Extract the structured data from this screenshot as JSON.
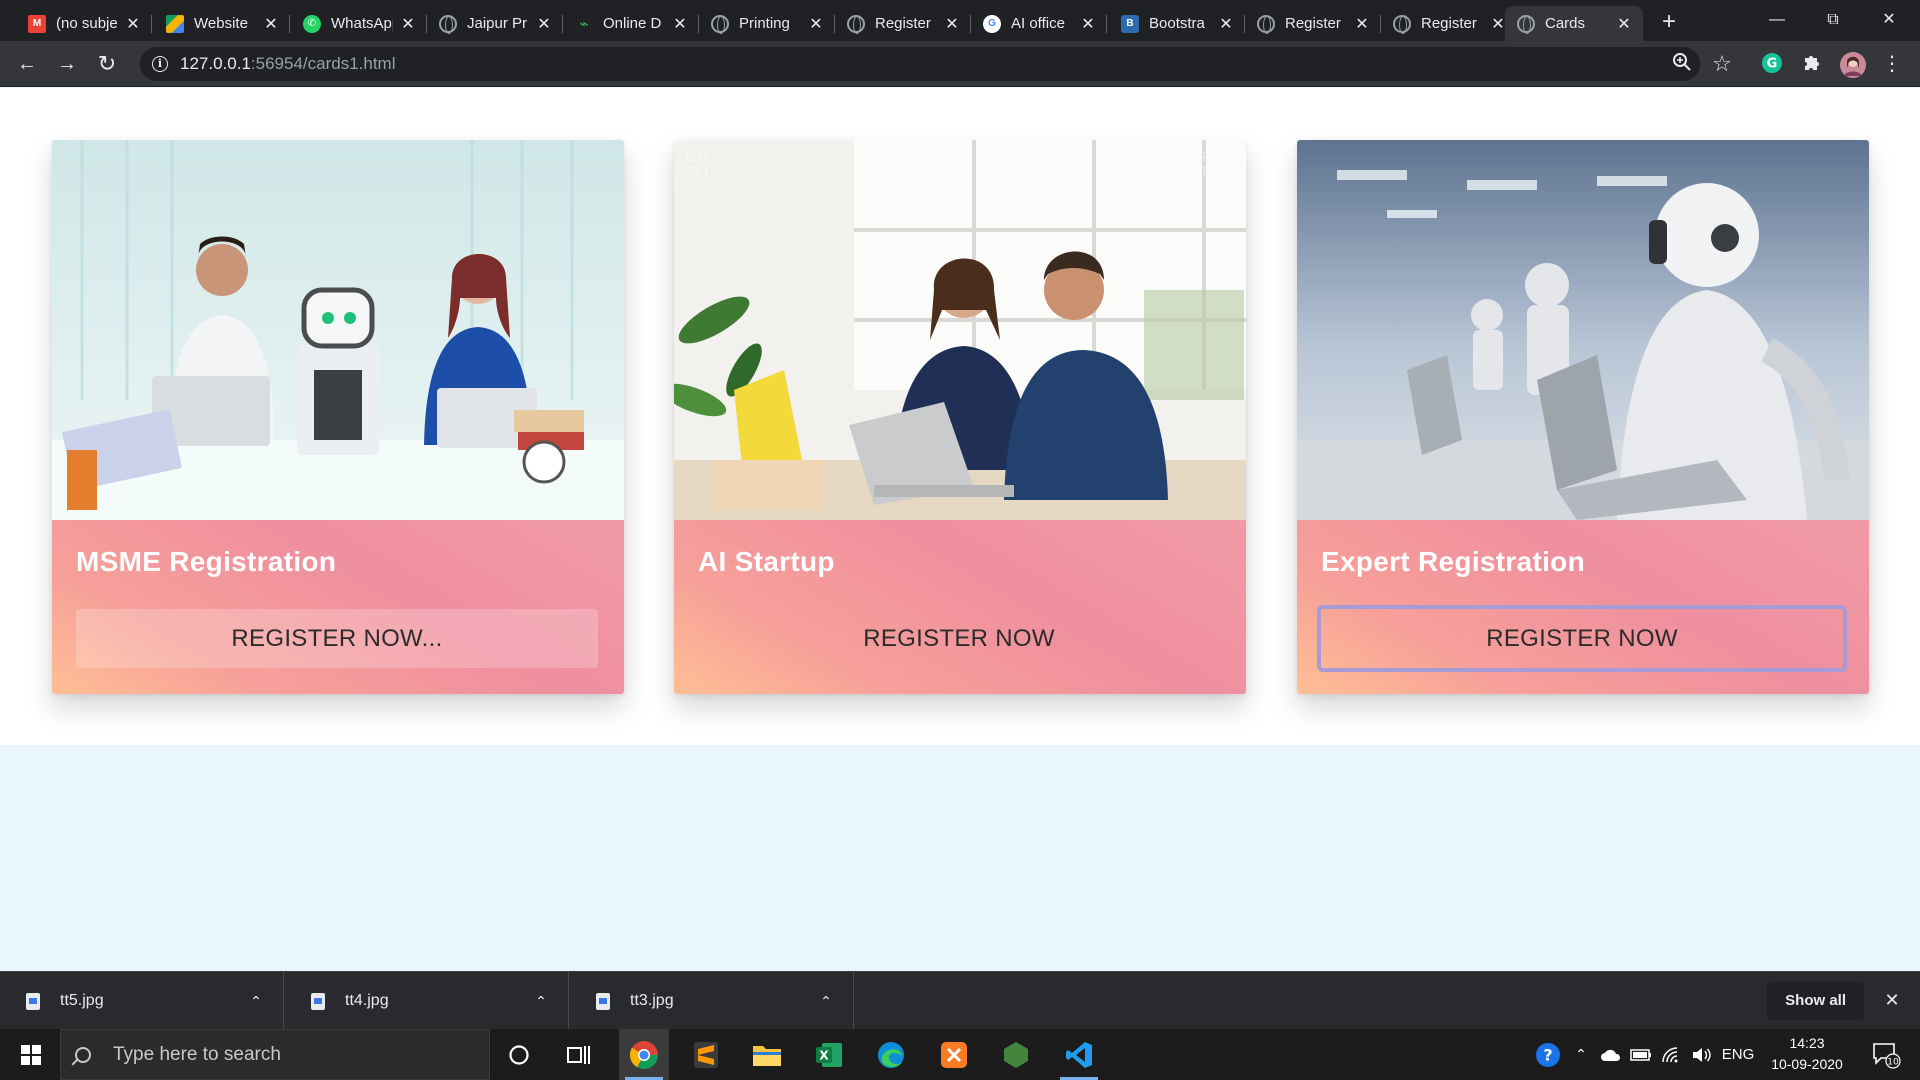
{
  "browser": {
    "tabs": [
      {
        "title": "(no subject)",
        "icon": "gmail-icon",
        "color": "#ea4335"
      },
      {
        "title": "Website",
        "icon": "drive-icon",
        "color": "#4285f4"
      },
      {
        "title": "WhatsApp",
        "icon": "whatsapp-icon",
        "color": "#25d366"
      },
      {
        "title": "Jaipur Pr",
        "icon": "globe-icon",
        "color": "#9aa0a6"
      },
      {
        "title": "Online D",
        "icon": "online-icon",
        "color": "#34a853"
      },
      {
        "title": "Printing",
        "icon": "globe-icon",
        "color": "#9aa0a6"
      },
      {
        "title": "Register",
        "icon": "globe-icon",
        "color": "#9aa0a6"
      },
      {
        "title": "AI office",
        "icon": "google-icon",
        "color": "#4285f4"
      },
      {
        "title": "Bootstra",
        "icon": "bootstrap-icon",
        "color": "#2b6cb0"
      },
      {
        "title": "Register",
        "icon": "globe-icon",
        "color": "#9aa0a6"
      },
      {
        "title": "Register",
        "icon": "globe-icon",
        "color": "#9aa0a6"
      },
      {
        "title": "Cards",
        "icon": "globe-icon",
        "color": "#9aa0a6",
        "active": true
      }
    ],
    "close_glyph": "✕",
    "new_tab_glyph": "+",
    "url_host": "127.0.0.1",
    "url_rest": ":56954/cards1.html"
  },
  "cards": [
    {
      "title": "MSME Registration",
      "button": "REGISTER NOW...",
      "image": "office-robot-assistant-photo"
    },
    {
      "title": "AI Startup",
      "button": "REGISTER NOW",
      "image": "couple-laptop-office-photo"
    },
    {
      "title": "Expert Registration",
      "button": "REGISTER NOW",
      "image": "robots-laptops-photo"
    }
  ],
  "colors": {
    "card_gradient": [
      "#ffbe95",
      "#ef8f9f"
    ],
    "outline_button": "#a69bd4",
    "page_bg": "#eaf6fd"
  },
  "downloads": {
    "items": [
      {
        "name": "tt5.jpg"
      },
      {
        "name": "tt4.jpg"
      },
      {
        "name": "tt3.jpg"
      }
    ],
    "show_all": "Show all"
  },
  "taskbar": {
    "search_placeholder": "Type here to search",
    "language": "ENG",
    "time": "14:23",
    "date": "10-09-2020",
    "notifications": "10"
  }
}
